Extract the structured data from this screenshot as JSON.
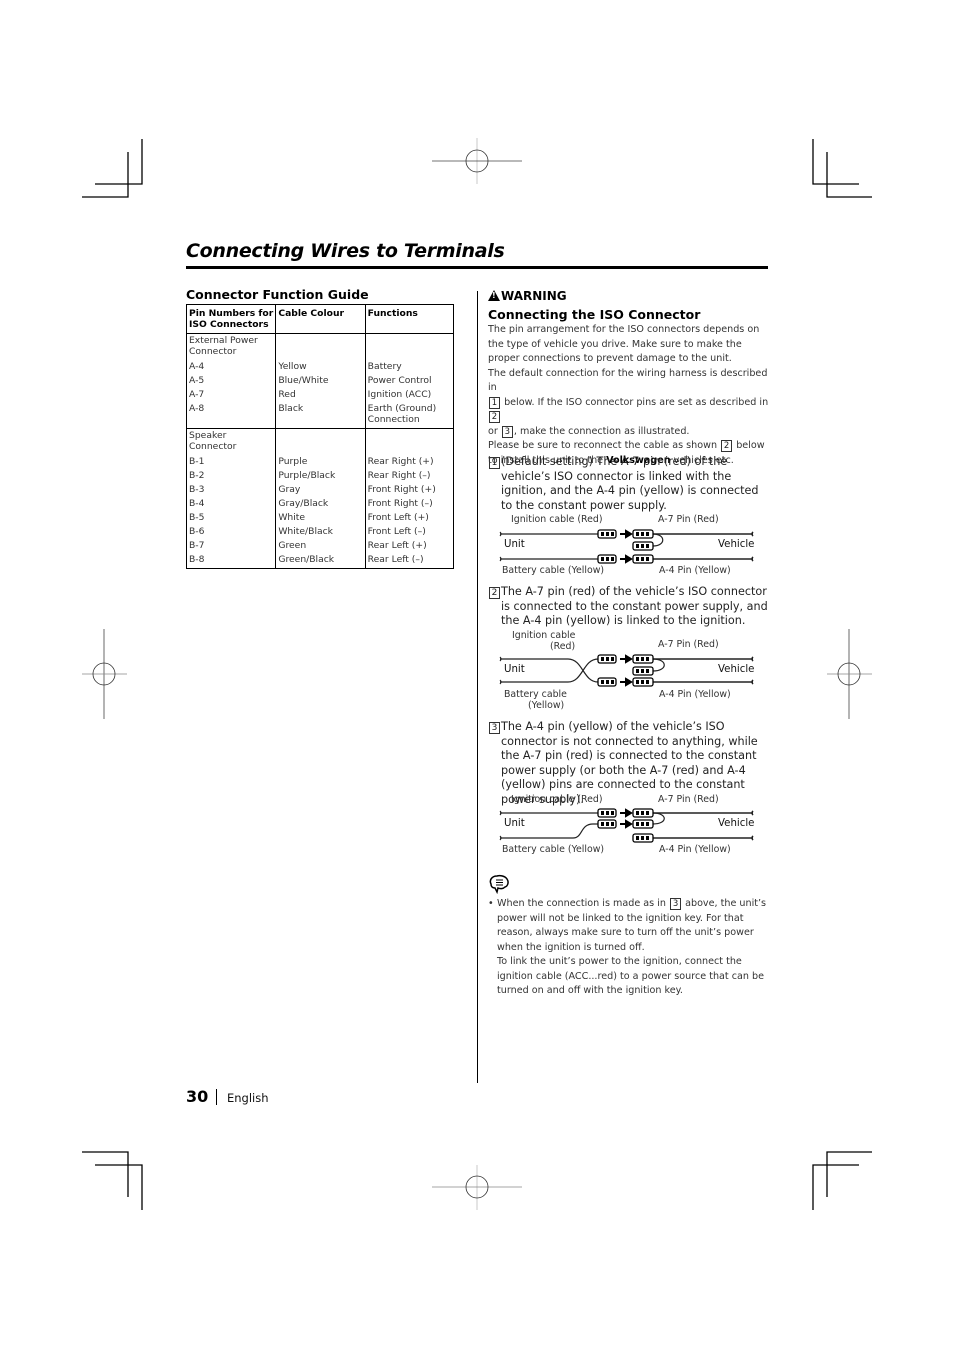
{
  "page": {
    "title": "Connecting Wires to Terminals",
    "page_number": "30",
    "language": "English"
  },
  "guide": {
    "heading": "Connector Function Guide",
    "columns": [
      "Pin Numbers for ISO Connectors",
      "Cable Colour",
      "Functions"
    ],
    "groups": [
      {
        "name": "External Power Connector",
        "rows": [
          {
            "pin": "A-4",
            "colour": "Yellow",
            "function": "Battery"
          },
          {
            "pin": "A-5",
            "colour": "Blue/White",
            "function": "Power Control"
          },
          {
            "pin": "A-7",
            "colour": "Red",
            "function": "Ignition (ACC)"
          },
          {
            "pin": "A-8",
            "colour": "Black",
            "function": "Earth (Ground) Connection"
          }
        ]
      },
      {
        "name": "Speaker Connector",
        "rows": [
          {
            "pin": "B-1",
            "colour": "Purple",
            "function": "Rear Right (+)"
          },
          {
            "pin": "B-2",
            "colour": "Purple/Black",
            "function": "Rear Right (–)"
          },
          {
            "pin": "B-3",
            "colour": "Gray",
            "function": "Front Right (+)"
          },
          {
            "pin": "B-4",
            "colour": "Gray/Black",
            "function": "Front Right (–)"
          },
          {
            "pin": "B-5",
            "colour": "White",
            "function": "Front Left (+)"
          },
          {
            "pin": "B-6",
            "colour": "White/Black",
            "function": "Front Left (–)"
          },
          {
            "pin": "B-7",
            "colour": "Green",
            "function": "Rear Left (+)"
          },
          {
            "pin": "B-8",
            "colour": "Green/Black",
            "function": "Rear Left (–)"
          }
        ]
      }
    ]
  },
  "iso": {
    "warning_label": "WARNING",
    "warning_icon": "warning-triangle-icon",
    "heading": "Connecting the ISO Connector",
    "intro": {
      "p1": "The pin arrangement for the ISO connectors depends on the type of vehicle you drive. Make sure to make the proper connections to prevent damage to the unit.",
      "p2_a": "The default connection for the wiring harness is described in",
      "p2_b": "below. If the ISO connector pins are set as described in",
      "p2_c": "or",
      "p2_d": ", make the connection as illustrated.",
      "p3_a": "Please be sure to reconnect the cable as shown",
      "p3_b": "below to install this unit to the",
      "p3_bold": "Volkswagen",
      "p3_c": "vehicles etc.",
      "ref1": "1",
      "ref2": "2",
      "ref3": "3",
      "ref4": "2"
    },
    "steps": [
      {
        "number": "1",
        "text": "(Default setting) The A-7 pin (red) of the vehicle’s ISO connector is linked with the ignition, and the A-4 pin (yellow) is connected to the constant power supply.",
        "labels": {
          "ignition": "Ignition cable (Red)",
          "a7": "A-7 Pin (Red)",
          "unit": "Unit",
          "vehicle": "Vehicle",
          "battery": "Battery cable (Yellow)",
          "a4": "A-4 Pin (Yellow)"
        }
      },
      {
        "number": "2",
        "text": "The A-7 pin (red) of the vehicle’s ISO connector is connected to the constant power supply, and the A-4 pin (yellow) is linked to the ignition.",
        "labels": {
          "ignition_1": "Ignition cable",
          "ignition_2": "(Red)",
          "a7": "A-7 Pin (Red)",
          "unit": "Unit",
          "vehicle": "Vehicle",
          "battery_1": "Battery cable",
          "battery_2": "(Yellow)",
          "a4": "A-4 Pin (Yellow)"
        }
      },
      {
        "number": "3",
        "text": "The A-4 pin (yellow) of the vehicle’s ISO connector is not connected to anything, while the A-7 pin (red) is connected to the constant power supply (or both the A-7 (red) and A-4 (yellow) pins are connected to the constant power supply).",
        "labels": {
          "ignition": "Ignition cable (Red)",
          "a7": "A-7 Pin (Red)",
          "unit": "Unit",
          "vehicle": "Vehicle",
          "battery": "Battery cable (Yellow)",
          "a4": "A-4 Pin (Yellow)"
        }
      }
    ],
    "note": {
      "icon": "note-speech-bubble-icon",
      "bullet": "•",
      "a": "When the connection is made as in",
      "ref": "3",
      "b": "above, the unit’s power will not be linked to the ignition key. For that reason, always make sure to turn off the unit’s power when the ignition is turned off.",
      "c": "To link the unit’s power to the ignition, connect the ignition cable (ACC...red) to a power source that can be turned on and off with the ignition key."
    }
  }
}
